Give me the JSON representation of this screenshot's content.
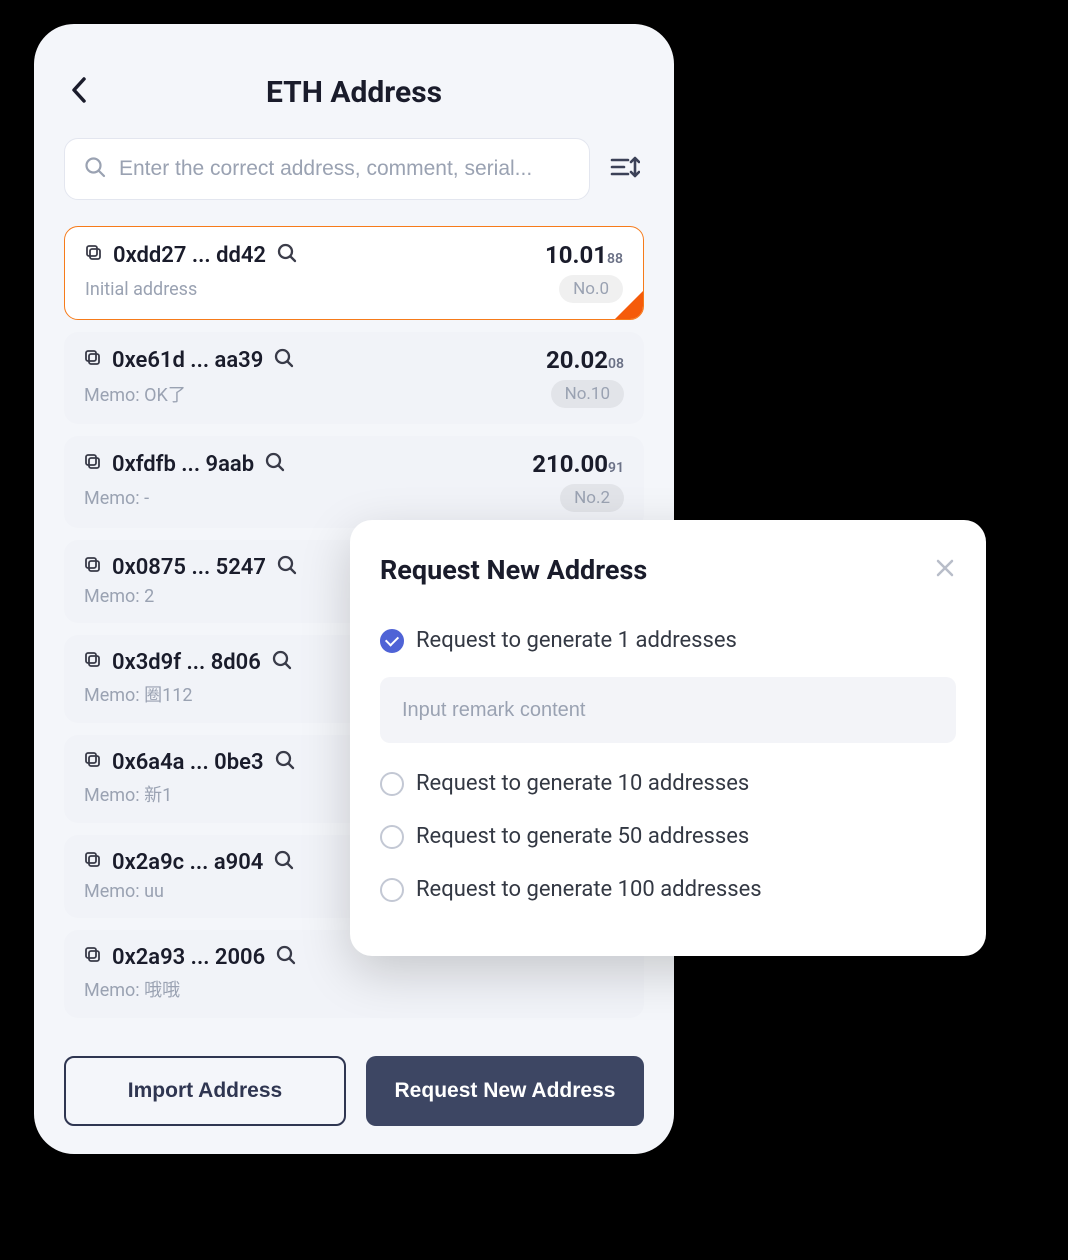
{
  "header": {
    "title": "ETH Address"
  },
  "search": {
    "placeholder": "Enter the correct address, comment, serial...",
    "value": ""
  },
  "addresses": [
    {
      "addr": "0xdd27 ... dd42",
      "balance_main": "10.01",
      "balance_sub": "88",
      "memo": "Initial address",
      "badge": "No.0",
      "selected": true
    },
    {
      "addr": "0xe61d ... aa39",
      "balance_main": "20.02",
      "balance_sub": "08",
      "memo": "Memo: OK了",
      "badge": "No.10",
      "selected": false
    },
    {
      "addr": "0xfdfb ... 9aab",
      "balance_main": "210.00",
      "balance_sub": "91",
      "memo": "Memo: -",
      "badge": "No.2",
      "selected": false
    },
    {
      "addr": "0x0875 ... 5247",
      "balance_main": "",
      "balance_sub": "",
      "memo": "Memo: 2",
      "badge": "",
      "selected": false
    },
    {
      "addr": "0x3d9f ... 8d06",
      "balance_main": "",
      "balance_sub": "",
      "memo": "Memo: 圈112",
      "badge": "",
      "selected": false
    },
    {
      "addr": "0x6a4a ... 0be3",
      "balance_main": "",
      "balance_sub": "",
      "memo": "Memo: 新1",
      "badge": "",
      "selected": false
    },
    {
      "addr": "0x2a9c ... a904",
      "balance_main": "",
      "balance_sub": "",
      "memo": "Memo: uu",
      "badge": "",
      "selected": false
    },
    {
      "addr": "0x2a93 ... 2006",
      "balance_main": "",
      "balance_sub": "",
      "memo": "Memo: 哦哦",
      "badge": "",
      "selected": false
    }
  ],
  "actions": {
    "import_label": "Import Address",
    "request_label": "Request New Address"
  },
  "modal": {
    "title": "Request New Address",
    "remark_placeholder": "Input remark content",
    "options": [
      {
        "label": "Request to generate 1 addresses",
        "checked": true
      },
      {
        "label": "Request to generate 10 addresses",
        "checked": false
      },
      {
        "label": "Request to generate 50 addresses",
        "checked": false
      },
      {
        "label": "Request to generate 100 addresses",
        "checked": false
      }
    ]
  }
}
